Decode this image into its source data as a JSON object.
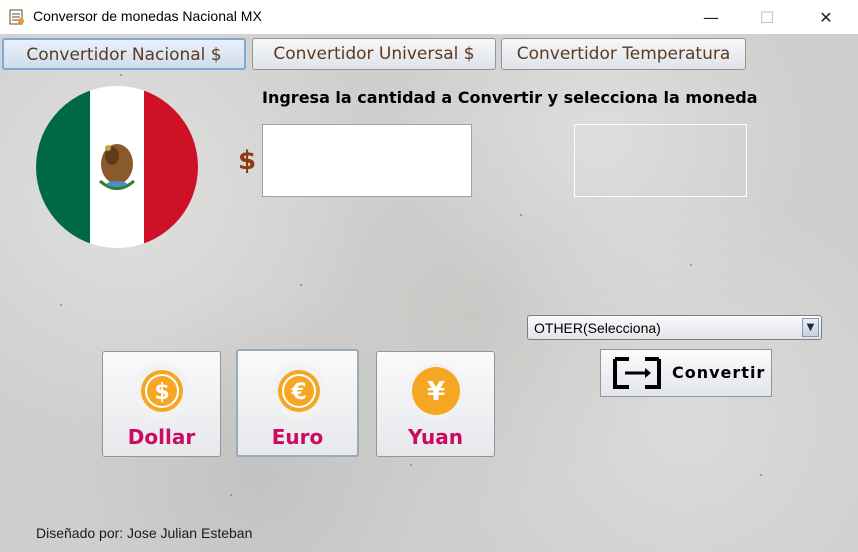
{
  "window": {
    "title": "Conversor de monedas Nacional MX",
    "app_icon": "spreadsheet-icon",
    "minimize_icon": "minimize-icon",
    "maximize_icon": "maximize-icon",
    "close_icon": "close-icon"
  },
  "tabs": [
    {
      "label": "Convertidor Nacional $",
      "active": true
    },
    {
      "label": "Convertidor Universal $",
      "active": false
    },
    {
      "label": "Convertidor Temperatura",
      "active": false
    }
  ],
  "flag": {
    "icon": "mexico-flag-icon",
    "colors": [
      "#006847",
      "#ffffff",
      "#ce1126"
    ]
  },
  "instruction": "Ingresa la cantidad a Convertir y selecciona la moneda",
  "amount": {
    "currency_symbol": "$",
    "value": ""
  },
  "result": {
    "value": ""
  },
  "currency_select": {
    "selected": "OTHER(Selecciona)"
  },
  "convert_button": {
    "label": "Convertir",
    "icon": "exchange-icon"
  },
  "currency_buttons": [
    {
      "label": "Dollar",
      "symbol": "$",
      "icon": "dollar-coin-icon",
      "selected": false
    },
    {
      "label": "Euro",
      "symbol": "€",
      "icon": "euro-coin-icon",
      "selected": true
    },
    {
      "label": "Yuan",
      "symbol": "¥",
      "icon": "yuan-coin-icon",
      "selected": false
    }
  ],
  "credit": "Diseñado por: Jose Julian Esteban",
  "colors": {
    "label_magenta": "#cc0a64",
    "tab_text": "#5a3a22",
    "coin_gold": "#f5a623"
  }
}
